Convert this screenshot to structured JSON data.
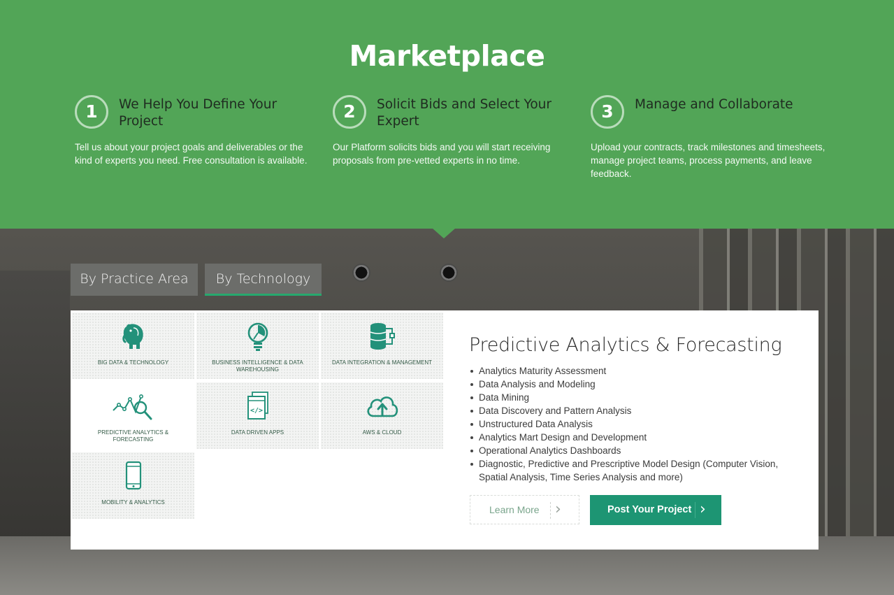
{
  "hero": {
    "title": "Marketplace",
    "steps": [
      {
        "number": "1",
        "title": "We Help You Define Your Project",
        "description": "Tell us about your project goals and deliverables or the kind of experts you need. Free consultation is available."
      },
      {
        "number": "2",
        "title": "Solicit Bids and Select Your Expert",
        "description": "Our Platform solicits bids and you will start receiving proposals from pre-vetted experts in no time."
      },
      {
        "number": "3",
        "title": "Manage and Collaborate",
        "description": "Upload your contracts, track milestones and timesheets, manage project teams, process payments, and leave feedback."
      }
    ]
  },
  "tabs": [
    {
      "label": "By Practice Area",
      "active": false
    },
    {
      "label": "By Technology",
      "active": true
    }
  ],
  "tiles": [
    {
      "label": "Big Data & Technology",
      "icon": "elephant-icon"
    },
    {
      "label": "Business Intelligence & Data Warehousing",
      "icon": "lightbulb-chart-icon"
    },
    {
      "label": "Data Integration & Management",
      "icon": "database-flow-icon"
    },
    {
      "label": "Predictive Analytics & Forecasting",
      "icon": "trend-magnifier-icon"
    },
    {
      "label": "Data Driven Apps",
      "icon": "code-window-icon"
    },
    {
      "label": "AWS & Cloud",
      "icon": "cloud-upload-icon"
    },
    {
      "label": "Mobility & Analytics",
      "icon": "mobile-phone-icon"
    }
  ],
  "detail": {
    "title": "Predictive Analytics & Forecasting",
    "items": [
      "Analytics Maturity Assessment",
      "Data Analysis and Modeling",
      "Data Mining",
      "Data Discovery and Pattern Analysis",
      "Unstructured Data Analysis",
      "Analytics Mart Design and Development",
      "Operational Analytics Dashboards",
      "Diagnostic, Predictive and Prescriptive Model Design (Computer Vision, Spatial Analysis, Time Series Analysis and more)"
    ],
    "learn_more_label": "Learn More",
    "post_project_label": "Post Your Project"
  },
  "colors": {
    "hero_green": "#52a557",
    "accent_teal": "#1d9573",
    "tab_underline": "#27a86e"
  }
}
